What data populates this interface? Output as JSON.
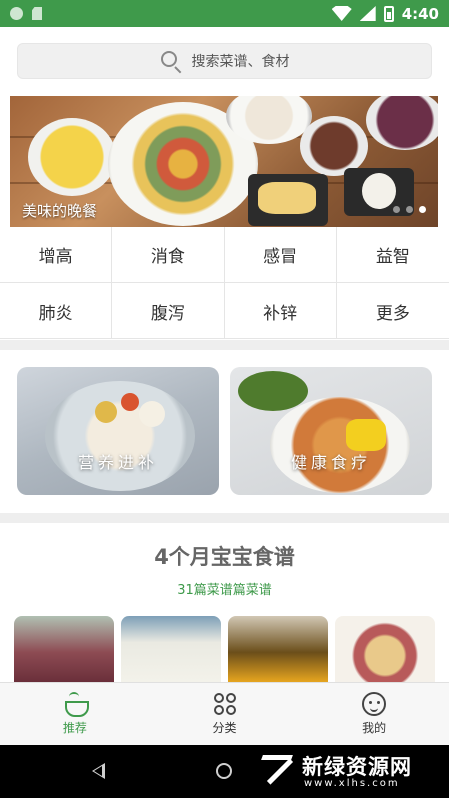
{
  "status_bar": {
    "time": "4:40"
  },
  "search": {
    "placeholder": "搜索菜谱、食材"
  },
  "banner": {
    "title": "美味的晚餐",
    "page_count": 3,
    "active_page": 3
  },
  "categories": [
    "增高",
    "消食",
    "感冒",
    "益智",
    "肺炎",
    "腹泻",
    "补锌",
    "更多"
  ],
  "features": [
    {
      "label": "营养进补"
    },
    {
      "label": "健康食疗"
    }
  ],
  "section": {
    "title": "4个月宝宝食谱",
    "subtitle": "31篇菜谱篇菜谱"
  },
  "tabs": [
    {
      "label": "推荐",
      "icon": "pot-icon",
      "active": true
    },
    {
      "label": "分类",
      "icon": "grid-icon",
      "active": false
    },
    {
      "label": "我的",
      "icon": "face-icon",
      "active": false
    }
  ],
  "watermark": {
    "title": "新绿资源网",
    "url": "www.xlhs.com"
  },
  "colors": {
    "accent": "#3f9a4b",
    "status_bar": "#3f9a4b",
    "nav_bar": "#000000"
  }
}
